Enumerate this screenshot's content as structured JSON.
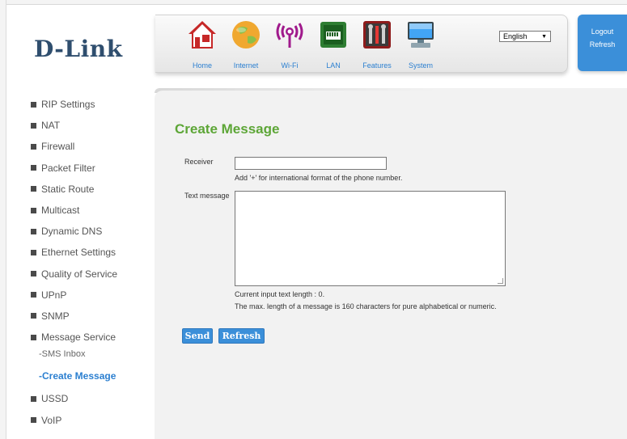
{
  "brand": {
    "logo_text": "D-Link",
    "accent": "#2b7fd0",
    "title_color": "#5da637"
  },
  "nav": [
    {
      "label": "Home",
      "icon": "home-icon"
    },
    {
      "label": "Internet",
      "icon": "globe-icon"
    },
    {
      "label": "Wi-Fi",
      "icon": "wifi-icon"
    },
    {
      "label": "LAN",
      "icon": "lan-icon"
    },
    {
      "label": "Features",
      "icon": "tools-icon"
    },
    {
      "label": "System",
      "icon": "computer-icon"
    }
  ],
  "language": {
    "selected": "English"
  },
  "account": {
    "logout": "Logout",
    "refresh": "Refresh"
  },
  "sidebar": {
    "items": [
      "RIP Settings",
      "NAT",
      "Firewall",
      "Packet Filter",
      "Static Route",
      "Multicast",
      "Dynamic DNS",
      "Ethernet Settings",
      "Quality of Service",
      "UPnP",
      "SNMP",
      "Message Service"
    ],
    "sub_items": [
      "-SMS Inbox",
      "-Create Message"
    ],
    "items_after": [
      "USSD",
      "VoIP"
    ]
  },
  "page": {
    "title": "Create Message",
    "receiver_label": "Receiver",
    "receiver_value": "",
    "receiver_hint": "Add '+' for international format of the phone number.",
    "text_label": "Text message",
    "text_value": "",
    "length_info": "Current input text length : 0.",
    "max_info": "The max. length of a message is 160 characters for pure alphabetical or numeric.",
    "send_label": "Send",
    "refresh_label": "Refresh"
  }
}
